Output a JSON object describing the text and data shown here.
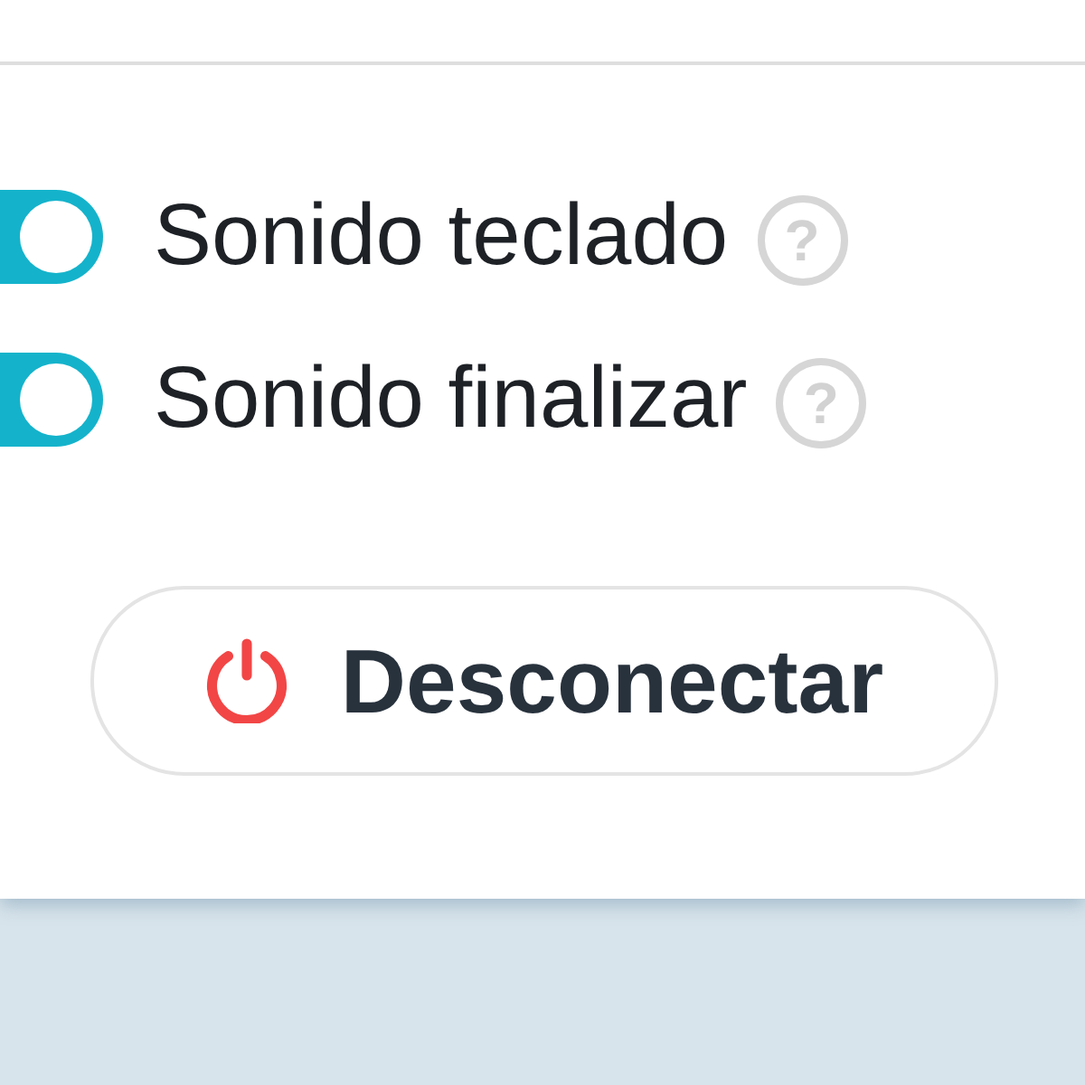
{
  "toggles": [
    {
      "label": "Sonido teclado",
      "on": true,
      "help": "?"
    },
    {
      "label": "Sonido finalizar",
      "on": true,
      "help": "?"
    }
  ],
  "disconnect_button": {
    "label": "Desconectar"
  }
}
